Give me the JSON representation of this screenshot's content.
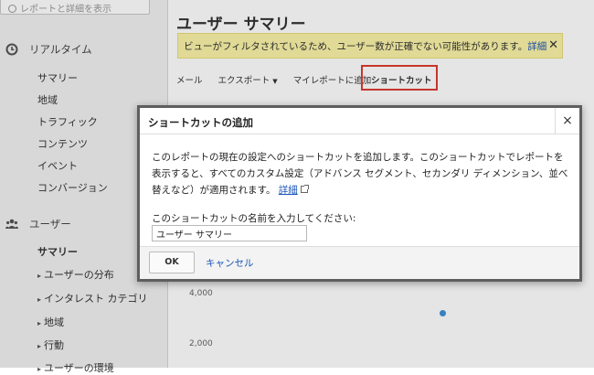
{
  "sidebar": {
    "search_placeholder": "レポートと詳細を表示",
    "realtime": {
      "label": "リアルタイム",
      "items": [
        "サマリー",
        "地域",
        "トラフィック",
        "コンテンツ",
        "イベント",
        "コンバージョン"
      ]
    },
    "users": {
      "label": "ユーザー",
      "items": [
        "サマリー",
        "ユーザーの分布",
        "インタレスト カテゴリ",
        "地域",
        "行動",
        "ユーザーの環境"
      ]
    }
  },
  "main": {
    "title": "ユーザー サマリー",
    "notice": {
      "text": "ビューがフィルタされているため、ユーザー数が正確でない可能性があります。",
      "link": "詳細"
    },
    "toolbar": {
      "mail": "メール",
      "export": "エクスポート",
      "my_reports": "マイレポートに追加",
      "shortcut": "ショートカット"
    },
    "chart": {
      "tick_4000": "4,000",
      "tick_2000": "2,000"
    }
  },
  "dialog": {
    "title": "ショートカットの追加",
    "close": "×",
    "description": "このレポートの現在の設定へのショートカットを追加します。このショートカットでレポートを表示すると、すべてのカスタム設定（アドバンス セグメント、セカンダリ ディメンション、並べ替えなど）が適用されます。",
    "details_link": "詳細",
    "name_label": "このショートカットの名前を入力してください:",
    "name_value": "ユーザー サマリー",
    "ok": "OK",
    "cancel": "キャンセル"
  }
}
